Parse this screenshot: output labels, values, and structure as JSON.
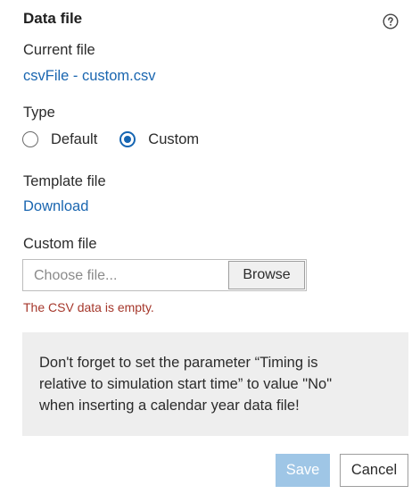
{
  "header": {
    "title": "Data file",
    "help_icon": "question-circle-icon"
  },
  "current_file": {
    "label": "Current file",
    "value": "csvFile - custom.csv"
  },
  "type": {
    "label": "Type",
    "options": [
      {
        "label": "Default",
        "selected": false
      },
      {
        "label": "Custom",
        "selected": true
      }
    ]
  },
  "template_file": {
    "label": "Template file",
    "link": "Download"
  },
  "custom_file": {
    "label": "Custom file",
    "placeholder": "Choose file...",
    "browse_label": "Browse",
    "error": "The CSV data is empty."
  },
  "info": {
    "lines": [
      "Don't forget to set the parameter “Timing is",
      "relative to simulation start time” to value \"No\"",
      "when inserting a calendar year data file!"
    ]
  },
  "footer": {
    "save_label": "Save",
    "cancel_label": "Cancel"
  },
  "colors": {
    "accent": "#1565b2",
    "link": "#1a66b0",
    "error": "#a5372b",
    "save_disabled": "#9fc6e6",
    "info_bg": "#eeeeee"
  }
}
